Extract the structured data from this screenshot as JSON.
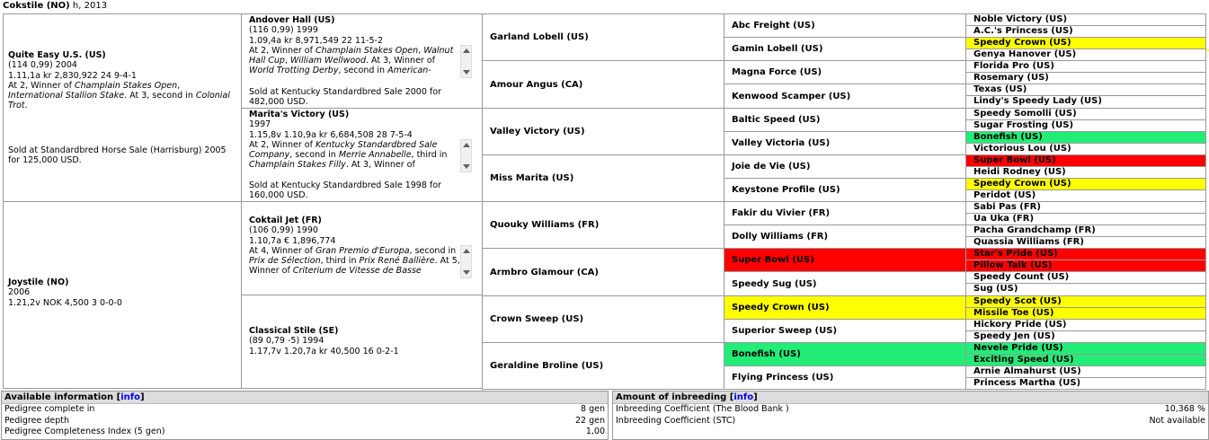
{
  "header": {
    "horse": "Cokstile (NO)",
    "info": "h, 2013"
  },
  "gen1": [
    {
      "name": "Quite Easy U.S. (US)",
      "lines": [
        "(114 0,99) 2004",
        "1.11,1a kr 2,830,922 24 9-4-1"
      ],
      "notes": [
        "At 2, Winner of ",
        "Champlain Stakes Open",
        ", ",
        "International Stallion Stake",
        ". At 3, second in ",
        "Colonial Trot",
        "."
      ],
      "sale": "Sold at Standardbred Horse Sale (Harrisburg) 2005 for 125,000 USD."
    },
    {
      "name": "Joystile (NO)",
      "lines": [
        "2006",
        "1.21,2v  NOK 4,500 3 0-0-0"
      ]
    }
  ],
  "gen2": [
    {
      "name": "Andover Hall (US)",
      "lines": [
        "(116 0,99) 1999",
        "1.09,4a kr 8,971,549 22 11-5-2"
      ],
      "notes": [
        "At 2, Winner of ",
        "Champlain Stakes Open",
        ", ",
        "Walnut Hall Cup",
        ", ",
        "William Wellwood",
        ". At 3, Winner of ",
        "World Trotting Derby",
        ", second in ",
        "American-National",
        ","
      ],
      "sale": "Sold at Kentucky Standardbred Sale 2000 for 482,000 USD."
    },
    {
      "name": "Marita's Victory (US)",
      "lines": [
        "1997",
        "1.15,8v 1.10,9a kr 6,684,508 28 7-5-4"
      ],
      "notes": [
        "At 2, Winner of ",
        "Kentucky Standardbred Sale Company",
        ", second in ",
        "Merrie Annabelle",
        ", third in ",
        "Champlain Stakes Filly",
        ". At 3, Winner of"
      ],
      "sale": "Sold at Kentucky Standardbred Sale 1998 for 160,000 USD."
    },
    {
      "name": "Coktail Jet (FR)",
      "lines": [
        "(106 0,99) 1990",
        "1.10,7a € 1,896,774"
      ],
      "notes": [
        "At 4, Winner of ",
        "Gran Premio d'Europa",
        ", second in ",
        "Prix de Sélection",
        ", third in ",
        "Prix René Ballière",
        ". At 5, Winner of ",
        "Criterium de Vitesse de Basse",
        ""
      ]
    },
    {
      "name": "Classical Stile (SE)",
      "lines": [
        "(89 0,79 -5) 1994",
        "1.17,7v 1.20,7a kr 40,500 16 0-2-1"
      ]
    }
  ],
  "gen3": [
    "Garland Lobell (US)",
    "Amour Angus (CA)",
    "Valley Victory (US)",
    "Miss Marita (US)",
    "Quouky Williams (FR)",
    "Armbro Glamour (CA)",
    "Crown Sweep (US)",
    "Geraldine Broline (US)"
  ],
  "gen4": [
    {
      "name": "Abc Freight (US)",
      "hl": ""
    },
    {
      "name": "Gamin Lobell (US)",
      "hl": ""
    },
    {
      "name": "Magna Force (US)",
      "hl": ""
    },
    {
      "name": "Kenwood Scamper (US)",
      "hl": ""
    },
    {
      "name": "Baltic Speed (US)",
      "hl": ""
    },
    {
      "name": "Valley Victoria (US)",
      "hl": ""
    },
    {
      "name": "Joie de Vie (US)",
      "hl": ""
    },
    {
      "name": "Keystone Profile (US)",
      "hl": ""
    },
    {
      "name": "Fakir du Vivier (FR)",
      "hl": ""
    },
    {
      "name": "Dolly Williams (FR)",
      "hl": ""
    },
    {
      "name": "Super Bowl (US)",
      "hl": "red"
    },
    {
      "name": "Speedy Sug (US)",
      "hl": ""
    },
    {
      "name": "Speedy Crown (US)",
      "hl": "yellow"
    },
    {
      "name": "Superior Sweep (US)",
      "hl": ""
    },
    {
      "name": "Bonefish (US)",
      "hl": "green"
    },
    {
      "name": "Flying Princess (US)",
      "hl": ""
    }
  ],
  "gen5": [
    {
      "name": "Noble Victory (US)",
      "hl": ""
    },
    {
      "name": "A.C.'s Princess (US)",
      "hl": ""
    },
    {
      "name": "Speedy Crown (US)",
      "hl": "yellow"
    },
    {
      "name": "Genya Hanover (US)",
      "hl": ""
    },
    {
      "name": "Florida Pro (US)",
      "hl": ""
    },
    {
      "name": "Rosemary (US)",
      "hl": ""
    },
    {
      "name": "Texas (US)",
      "hl": ""
    },
    {
      "name": "Lindy's Speedy Lady (US)",
      "hl": ""
    },
    {
      "name": "Speedy Somolli (US)",
      "hl": ""
    },
    {
      "name": "Sugar Frosting (US)",
      "hl": ""
    },
    {
      "name": "Bonefish (US)",
      "hl": "green"
    },
    {
      "name": "Victorious Lou (US)",
      "hl": ""
    },
    {
      "name": "Super Bowl (US)",
      "hl": "red"
    },
    {
      "name": "Heidi Rodney (US)",
      "hl": ""
    },
    {
      "name": "Speedy Crown (US)",
      "hl": "yellow"
    },
    {
      "name": "Peridot (US)",
      "hl": ""
    },
    {
      "name": "Sabi Pas (FR)",
      "hl": ""
    },
    {
      "name": "Ua Uka (FR)",
      "hl": ""
    },
    {
      "name": "Pacha Grandchamp (FR)",
      "hl": ""
    },
    {
      "name": "Quassia Williams (FR)",
      "hl": ""
    },
    {
      "name": "Star's Pride (US)",
      "hl": "red"
    },
    {
      "name": "Pillow Talk (US)",
      "hl": "red"
    },
    {
      "name": "Speedy Count (US)",
      "hl": ""
    },
    {
      "name": "Sug (US)",
      "hl": ""
    },
    {
      "name": "Speedy Scot (US)",
      "hl": "yellow"
    },
    {
      "name": "Missile Toe (US)",
      "hl": "yellow"
    },
    {
      "name": "Hickory Pride (US)",
      "hl": ""
    },
    {
      "name": "Speedy Jen (US)",
      "hl": ""
    },
    {
      "name": "Nevele Pride (US)",
      "hl": "green"
    },
    {
      "name": "Exciting Speed (US)",
      "hl": "green"
    },
    {
      "name": "Arnie Almahurst (US)",
      "hl": ""
    },
    {
      "name": "Princess Martha (US)",
      "hl": ""
    }
  ],
  "colors": {
    "yellow": "#ffff00",
    "red": "#ff0000",
    "green": "#22ee77"
  },
  "available": {
    "title": "Available information",
    "info_link": "info",
    "rows": [
      {
        "label": "Pedigree complete in",
        "value": "8 gen"
      },
      {
        "label": "Pedigree depth",
        "value": "22 gen"
      },
      {
        "label": "Pedigree Completeness Index (5 gen)",
        "value": "1,00"
      }
    ]
  },
  "inbreeding": {
    "title": "Amount of inbreeding",
    "info_link": "info",
    "rows": [
      {
        "label": "Inbreeding Coefficient (The Blood Bank )",
        "value": "10,368 %"
      },
      {
        "label": "Inbreeding Coefficient (STC)",
        "value": "Not available"
      }
    ]
  }
}
